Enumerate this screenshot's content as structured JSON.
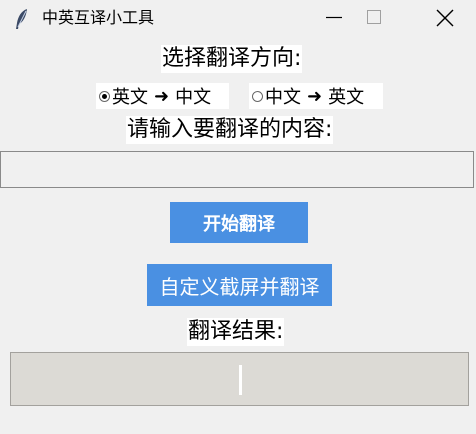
{
  "window": {
    "title": "中英互译小工具",
    "icon": "feather-icon",
    "controls": [
      "minimize-icon",
      "maximize-icon",
      "close-icon"
    ]
  },
  "direction": {
    "label": "选择翻译方向:",
    "options": [
      {
        "from": "英文",
        "arrow": "➜",
        "to": "中文",
        "selected": true
      },
      {
        "from": "中文",
        "arrow": "➜",
        "to": "英文",
        "selected": false
      }
    ]
  },
  "input": {
    "label": "请输入要翻译的内容:",
    "value": ""
  },
  "buttons": {
    "start": "开始翻译",
    "screenshot": "自定义截屏并翻译"
  },
  "result": {
    "label": "翻译结果:",
    "value": ""
  },
  "colors": {
    "background": "#f0f0f0",
    "button": "#4a90e2",
    "result_bg": "#dcdad5"
  }
}
